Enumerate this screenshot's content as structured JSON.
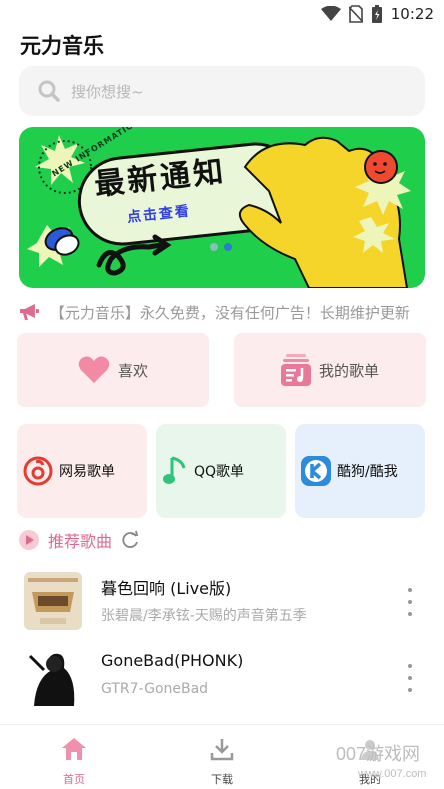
{
  "status": {
    "time": "10:22"
  },
  "app": {
    "title": "元力音乐"
  },
  "search": {
    "placeholder": "搜你想搜~"
  },
  "banner": {
    "title": "最新通知",
    "subtitle": "点击查看",
    "badge": "NEW INFORMATION",
    "active_slide": 2,
    "slide_count": 2
  },
  "notice": {
    "text": "【元力音乐】永久免费，没有任何广告！长期维护更新"
  },
  "quick_links": [
    {
      "label": "喜欢",
      "icon": "heart-icon"
    },
    {
      "label": "我的歌单",
      "icon": "playlist-icon"
    }
  ],
  "sources": [
    {
      "label": "网易歌单",
      "icon": "netease-icon",
      "bg": "#fdecec"
    },
    {
      "label": "QQ歌单",
      "icon": "qq-music-icon",
      "bg": "#e8f6ec"
    },
    {
      "label": "酷狗/酷我",
      "icon": "kugou-icon",
      "bg": "#e6f0fc"
    }
  ],
  "recommend": {
    "title": "推荐歌曲"
  },
  "songs": [
    {
      "title": "暮色回响 (Live版)",
      "artist": "张碧晨/李承铉-天赐的声音第五季"
    },
    {
      "title": "GoneBad(PHONK)",
      "artist": "GTR7-GoneBad"
    }
  ],
  "nav": [
    {
      "label": "首页",
      "icon": "home-icon",
      "active": true
    },
    {
      "label": "下载",
      "icon": "download-icon",
      "active": false
    },
    {
      "label": "我的",
      "icon": "profile-icon",
      "active": false
    }
  ],
  "watermark": {
    "main": "007游戏网",
    "sub": "www.007.com"
  },
  "colors": {
    "accent": "#e06a8d",
    "banner_bg": "#1fcf4c",
    "banner_blue": "#2f3ee6"
  }
}
